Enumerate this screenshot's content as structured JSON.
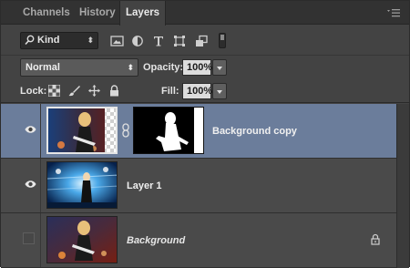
{
  "tabs": [
    {
      "label": "Channels"
    },
    {
      "label": "History"
    },
    {
      "label": "Layers"
    }
  ],
  "filter": {
    "kind_label": "Kind",
    "icons": [
      "image-filter-icon",
      "adjustment-filter-icon",
      "type-filter-icon",
      "shape-filter-icon",
      "smart-object-filter-icon",
      "filter-toggle-icon"
    ]
  },
  "blend": {
    "mode": "Normal",
    "opacity_label": "Opacity:",
    "opacity_value": "100%"
  },
  "lock": {
    "label": "Lock:",
    "icons": [
      "lock-transparent-pixels-icon",
      "lock-image-pixels-icon",
      "lock-position-icon",
      "lock-all-icon"
    ],
    "fill_label": "Fill:",
    "fill_value": "100%"
  },
  "layers": [
    {
      "name": "Background copy",
      "visible": true,
      "selected": true,
      "has_mask": true
    },
    {
      "name": "Layer 1",
      "visible": true,
      "selected": false,
      "has_mask": false
    },
    {
      "name": "Background",
      "visible": false,
      "selected": false,
      "locked": true
    }
  ],
  "colors": {
    "panel_bg": "#434343",
    "tabbar_bg": "#323232",
    "selected_row": "#6b7d9b"
  }
}
